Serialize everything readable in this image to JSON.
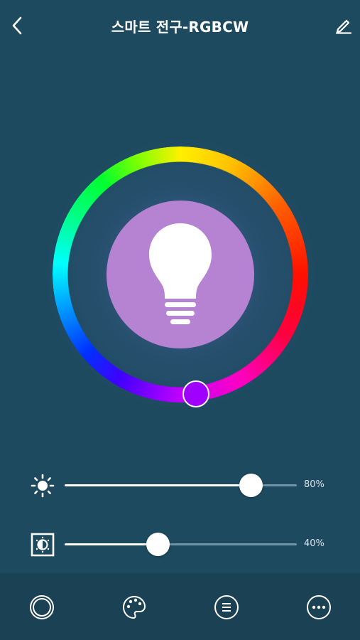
{
  "header": {
    "title": "스마트 전구-RGBCW",
    "back_icon": "chevron-left-icon",
    "edit_icon": "pencil-icon"
  },
  "color_wheel": {
    "selected_color": "#a000ff",
    "center_color": "#b683d3",
    "center_icon": "lightbulb-icon"
  },
  "brightness": {
    "icon": "sun-icon",
    "value": 80,
    "label": "80%"
  },
  "contrast": {
    "icon": "contrast-icon",
    "value": 40,
    "label": "40%"
  },
  "bottom_nav": [
    {
      "icon": "white-mode-icon"
    },
    {
      "icon": "palette-icon"
    },
    {
      "icon": "scene-list-icon"
    },
    {
      "icon": "more-icon"
    }
  ]
}
